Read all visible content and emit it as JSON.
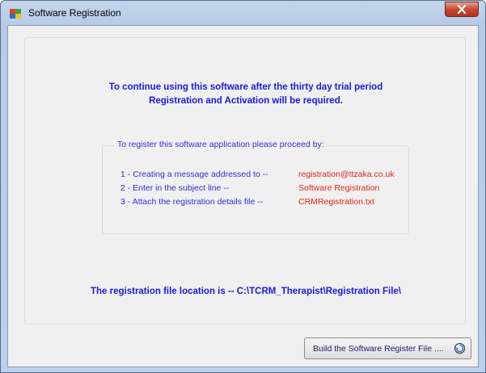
{
  "window": {
    "title": "Software Registration",
    "close_glyph": "✕"
  },
  "main": {
    "headline_line1": "To continue using this software after the thirty day trial period",
    "headline_line2": "Registration and Activation will be required.",
    "group_title": "To register this software application please proceed by:",
    "steps": [
      {
        "label": "1  -  Creating a message addressed to --",
        "value": "registration@ttzaka.co.uk"
      },
      {
        "label": "2  -  Enter in the subject line --",
        "value": "Software Registration"
      },
      {
        "label": "3  -  Attach the registration details file --",
        "value": "CRMRegistration.txt"
      }
    ],
    "location_text": "The registration file location is -- C:\\TCRM_Therapist\\Registration File\\"
  },
  "footer": {
    "build_button_label": "Build the Software  Register File ....",
    "build_button_icon": "disk-refresh-icon"
  },
  "colors": {
    "heading_blue": "#1a1adb",
    "value_red": "#e0251b",
    "close_red": "#c4432c"
  },
  "icons": {
    "app": "registration-app-icon",
    "close": "close-icon"
  }
}
